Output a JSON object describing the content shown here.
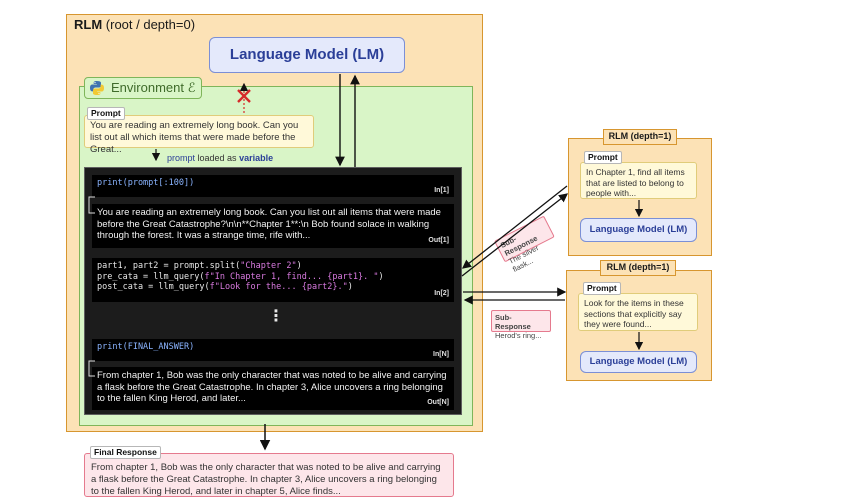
{
  "root": {
    "title_bold": "RLM",
    "title_rest": " (root / depth=0)",
    "lm_label": "Language Model (LM)"
  },
  "environment": {
    "label": "Environment ℰ",
    "prompt_tag": "Prompt",
    "prompt_text": "You are reading an extremely long book. Can you list out all which items that were made before the Great...",
    "loaded_prefix": "prompt",
    "loaded_mid": " loaded as ",
    "loaded_suffix": "variable"
  },
  "repl": {
    "cell1_code": "print(prompt[:100])",
    "cell1_tag": "In[1]",
    "out1_text": "You are reading an extremely long book. Can you list out all items that were made before the Great Catastrophe?\\n\\n**Chapter 1**:\\n Bob found solace in walking through the forest. It was a strange time, rife with...",
    "out1_tag": "Out[1]",
    "cell2_line1a": "part1, part2 = prompt.split(",
    "cell2_line1b": "\"Chapter 2\"",
    "cell2_line1c": ")",
    "cell2_line2a": "pre_cata = llm_query(",
    "cell2_line2b": "f\"In Chapter 1, find... {part1}. \"",
    "cell2_line2c": ")",
    "cell2_line3a": "post_cata = llm_query(",
    "cell2_line3b": "f\"Look for the... {part2}.\"",
    "cell2_line3c": ")",
    "cell2_tag": "In[2]",
    "ellipsis": "⋮",
    "cellN_code": "print(FINAL_ANSWER)",
    "cellN_tag": "In[N]",
    "outN_text": "From chapter 1, Bob was the only character that was noted to be alive and carrying a flask before the Great Catastrophe. In chapter 3, Alice uncovers a ring belonging to the fallen King Herod, and later...",
    "outN_tag": "Out[N]"
  },
  "sub_rlm_1": {
    "title": "RLM (depth=1)",
    "prompt_tag": "Prompt",
    "prompt_text": "In Chapter 1, find all items that are listed to belong to people with...",
    "lm_label": "Language Model (LM)"
  },
  "sub_rlm_2": {
    "title": "RLM (depth=1)",
    "prompt_tag": "Prompt",
    "prompt_text": "Look for the items in these sections that explicitly say they were found...",
    "lm_label": "Language Model (LM)"
  },
  "sub_response_1": {
    "tag": "Sub-Response",
    "text": "The silver flask..."
  },
  "sub_response_2": {
    "tag": "Sub-Response",
    "text": "Herod's ring..."
  },
  "final": {
    "tag": "Final Response",
    "text": "From chapter 1, Bob was the only character that was noted to be alive and carrying a flask before the Great Catastrophe. In chapter 3, Alice uncovers a ring belonging to the fallen King Herod, and later in chapter 5, Alice finds..."
  },
  "colors": {
    "rlm_fill": "#fce2b6",
    "rlm_border": "#d7962f",
    "env_fill": "#d9f5c7",
    "lm_fill": "#e4e9fb",
    "lm_text": "#2b3f98",
    "response_fill": "#fde6ea",
    "blocked_x": "#d62a2a"
  },
  "icons": [
    "python-icon",
    "blocked-x-icon"
  ]
}
